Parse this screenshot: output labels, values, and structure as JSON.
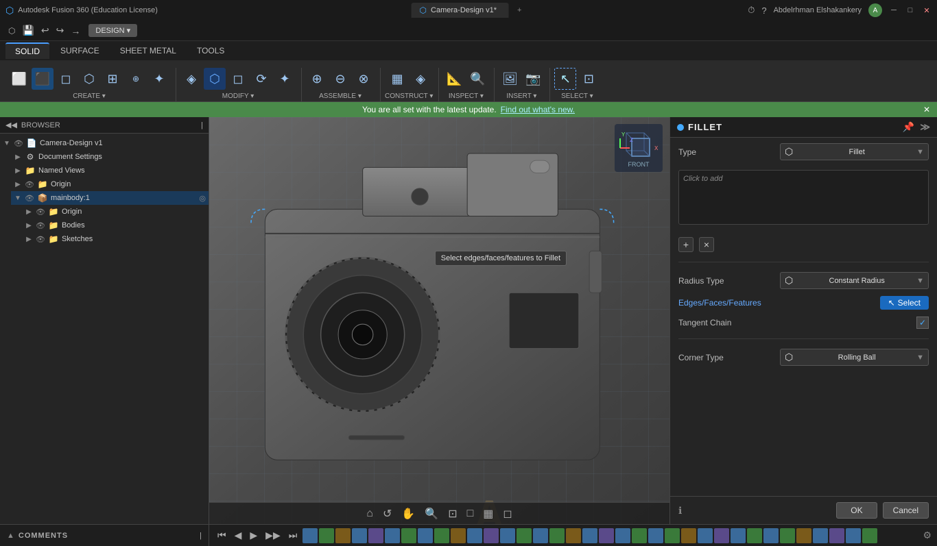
{
  "app": {
    "title": "Autodesk Fusion 360 (Education License)",
    "tab_title": "Camera-Design v1*",
    "tab_close": "×",
    "user": "Abdelrhman Elshakankery"
  },
  "titlebar": {
    "logo": "⬡",
    "title": "Autodesk Fusion 360 (Education License)",
    "minimize": "─",
    "maximize": "□",
    "close": "✕",
    "tab_add": "+",
    "help_icon": "?",
    "clock_icon": "⏱"
  },
  "quickaccess": {
    "icons": [
      "⬡",
      "💾",
      "↩",
      "↪",
      "→"
    ],
    "design_btn": "DESIGN ▾"
  },
  "tabs": [
    {
      "label": "SOLID",
      "active": true
    },
    {
      "label": "SURFACE",
      "active": false
    },
    {
      "label": "SHEET METAL",
      "active": false
    },
    {
      "label": "TOOLS",
      "active": false
    }
  ],
  "ribbon": {
    "groups": [
      {
        "label": "CREATE ▾",
        "icons": [
          "⬜",
          "⬛",
          "◻",
          "⬡",
          "⊞",
          "◈",
          "⟳"
        ]
      },
      {
        "label": "MODIFY ▾",
        "icons": [
          "◈",
          "⬡",
          "◻",
          "⟳",
          "✦"
        ]
      },
      {
        "label": "ASSEMBLE ▾",
        "icons": [
          "⊕",
          "⊖",
          "⊗"
        ]
      },
      {
        "label": "CONSTRUCT ▾",
        "icons": [
          "▦",
          "◈"
        ]
      },
      {
        "label": "INSPECT ▾",
        "icons": [
          "📐",
          "🔍"
        ]
      },
      {
        "label": "INSERT ▾",
        "icons": [
          "🖼",
          "📷"
        ]
      },
      {
        "label": "SELECT ▾",
        "icons": [
          "↖",
          "⊡"
        ]
      }
    ]
  },
  "notification": {
    "text": "You are all set with the latest update.",
    "link_text": "Find out what's new.",
    "close": "✕"
  },
  "browser": {
    "title": "BROWSER",
    "items": [
      {
        "label": "Camera-Design v1",
        "indent": 0,
        "toggle": "▼",
        "icon": "📄",
        "eye": true
      },
      {
        "label": "Document Settings",
        "indent": 1,
        "toggle": "▶",
        "icon": "⚙️",
        "eye": false
      },
      {
        "label": "Named Views",
        "indent": 1,
        "toggle": "▶",
        "icon": "📁",
        "eye": false
      },
      {
        "label": "Origin",
        "indent": 1,
        "toggle": "▶",
        "icon": "📁",
        "eye": false
      },
      {
        "label": "mainbody:1",
        "indent": 1,
        "toggle": "▼",
        "icon": "📦",
        "eye": true,
        "selected": true
      },
      {
        "label": "Origin",
        "indent": 2,
        "toggle": "▶",
        "icon": "📁",
        "eye": false
      },
      {
        "label": "Bodies",
        "indent": 2,
        "toggle": "▶",
        "icon": "📁",
        "eye": false
      },
      {
        "label": "Sketches",
        "indent": 2,
        "toggle": "▶",
        "icon": "📁",
        "eye": false
      }
    ]
  },
  "viewport": {
    "tooltip": "Select edges/faces/features to Fillet"
  },
  "fillet_panel": {
    "title": "FILLET",
    "type_label": "Type",
    "type_value": "Fillet",
    "type_icon": "⬡",
    "radius_type_label": "Radius Type",
    "radius_type_value": "Constant Radius",
    "radius_type_icon": "⬡",
    "edges_label": "Edges/Faces/Features",
    "select_btn": "Select",
    "select_icon": "↖",
    "tangent_chain_label": "Tangent Chain",
    "tangent_chain_checked": true,
    "corner_type_label": "Corner Type",
    "corner_type_value": "Rolling Ball",
    "corner_type_icon": "⬡",
    "add_btn": "+",
    "remove_btn": "×",
    "ok_btn": "OK",
    "cancel_btn": "Cancel",
    "info_icon": "ℹ"
  },
  "comments": {
    "label": "COMMENTS"
  },
  "timeline": {
    "btns": [
      "⏮",
      "◀",
      "⏸",
      "▶",
      "⏭"
    ],
    "items_count": 35
  }
}
